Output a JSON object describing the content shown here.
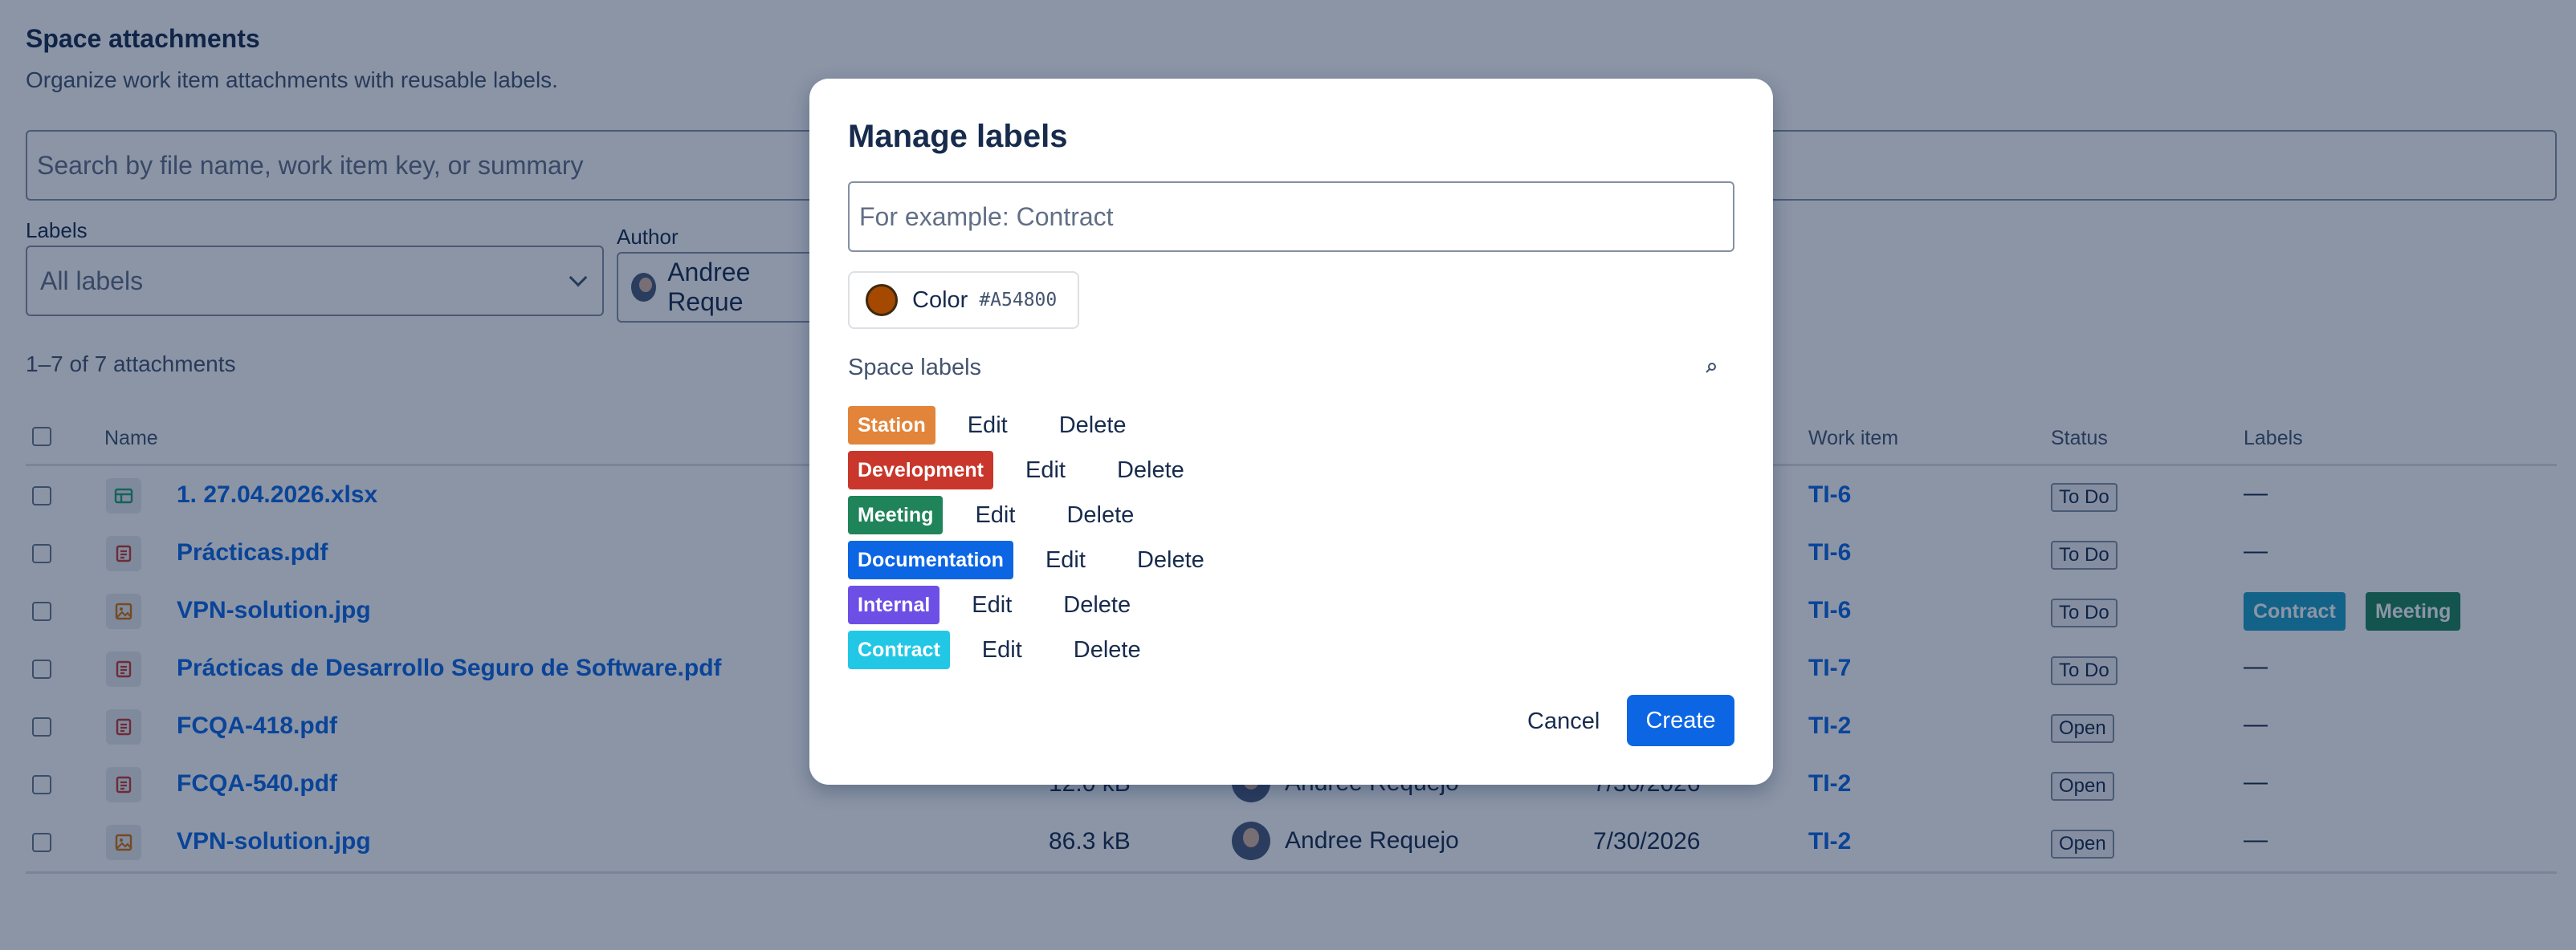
{
  "page": {
    "title": "Space attachments",
    "subtitle": "Organize work item attachments with reusable labels.",
    "search_placeholder": "Search by file name, work item key, or summary",
    "filters": {
      "labels_label": "Labels",
      "labels_value": "All labels",
      "author_label": "Author",
      "author_value": "Andree Reque"
    },
    "count_text": "1–7 of 7 attachments",
    "table": {
      "headers": {
        "name": "Name",
        "work_item": "Work item",
        "status": "Status",
        "labels": "Labels"
      },
      "rows": [
        {
          "icon": "spreadsheet-icon",
          "name": "1. 27.04.2026.xlsx",
          "size": "",
          "author": "",
          "date": "",
          "work_item": "TI-6",
          "status": "To Do",
          "labels_text": "—",
          "labels": []
        },
        {
          "icon": "document-icon",
          "name": "Prácticas.pdf",
          "size": "",
          "author": "",
          "date": "",
          "work_item": "TI-6",
          "status": "To Do",
          "labels_text": "—",
          "labels": []
        },
        {
          "icon": "image-icon",
          "name": "VPN-solution.jpg",
          "size": "",
          "author": "",
          "date": "",
          "work_item": "TI-6",
          "status": "To Do",
          "labels_text": "",
          "labels": [
            {
              "name": "Contract",
              "color": "#1D9FC4"
            },
            {
              "name": "Meeting",
              "color": "#1F845A"
            }
          ]
        },
        {
          "icon": "document-icon",
          "name": "Prácticas de Desarrollo Seguro de Software.pdf",
          "size": "",
          "author": "",
          "date": "",
          "work_item": "TI-7",
          "status": "To Do",
          "labels_text": "—",
          "labels": []
        },
        {
          "icon": "document-icon",
          "name": "FCQA-418.pdf",
          "size": "",
          "author": "",
          "date": "",
          "work_item": "TI-2",
          "status": "Open",
          "labels_text": "—",
          "labels": []
        },
        {
          "icon": "document-icon",
          "name": "FCQA-540.pdf",
          "size": "12.0 kB",
          "author": "Andree Requejo",
          "date": "7/30/2026",
          "work_item": "TI-2",
          "status": "Open",
          "labels_text": "—",
          "labels": []
        },
        {
          "icon": "image-icon",
          "name": "VPN-solution.jpg",
          "size": "86.3 kB",
          "author": "Andree Requejo",
          "date": "7/30/2026",
          "work_item": "TI-2",
          "status": "Open",
          "labels_text": "—",
          "labels": []
        }
      ]
    }
  },
  "modal": {
    "title": "Manage labels",
    "input_placeholder": "For example: Contract",
    "color_label": "Color",
    "color_hex": "#A54800",
    "color_value": "#A54800",
    "space_labels_heading": "Space labels",
    "search_icon": "search-icon",
    "labels": [
      {
        "name": "Station",
        "color": "#E2843A",
        "edit": "Edit",
        "delete": "Delete"
      },
      {
        "name": "Development",
        "color": "#C9372C",
        "edit": "Edit",
        "delete": "Delete"
      },
      {
        "name": "Meeting",
        "color": "#1F845A",
        "edit": "Edit",
        "delete": "Delete"
      },
      {
        "name": "Documentation",
        "color": "#0C66E4",
        "edit": "Edit",
        "delete": "Delete"
      },
      {
        "name": "Internal",
        "color": "#6E4FE6",
        "edit": "Edit",
        "delete": "Delete"
      },
      {
        "name": "Contract",
        "color": "#22C7E6",
        "edit": "Edit",
        "delete": "Delete"
      }
    ],
    "cancel_label": "Cancel",
    "create_label": "Create"
  }
}
